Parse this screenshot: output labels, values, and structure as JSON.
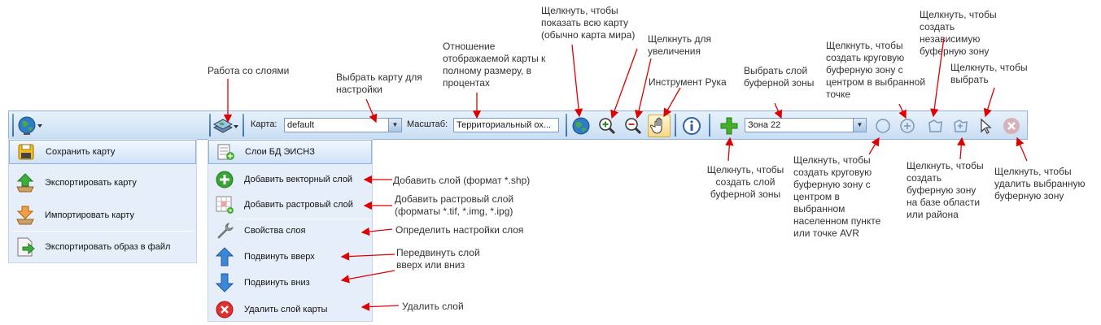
{
  "toolbar": {
    "map_label": "Карта:",
    "map_value": "default",
    "scale_label": "Масштаб:",
    "scale_value": "Территориальный ох...",
    "zone_value": "Зона 22"
  },
  "left_menu": {
    "items": [
      {
        "label": "Сохранить карту"
      },
      {
        "label": "Экспортировать карту"
      },
      {
        "label": "Импортировать карту"
      },
      {
        "label": "Экспортировать образ в файл"
      }
    ]
  },
  "layer_menu": {
    "items": [
      {
        "label": "Слои БД ЭИСНЗ"
      },
      {
        "label": "Добавить векторный слой"
      },
      {
        "label": "Добавить растровый слой"
      },
      {
        "label": "Свойства слоя"
      },
      {
        "label": "Подвинуть вверх"
      },
      {
        "label": "Подвинуть вниз"
      },
      {
        "label": "Удалить слой карты"
      }
    ]
  },
  "annotations": {
    "layers": "Работа со слоями",
    "choose_map": "Выбрать карту для настройки",
    "ratio": "Отношение отображаемой карты к полному размеру, в процентах",
    "whole_map": "Щелкнуть, чтобы показать всю карту (обычно карта мира)",
    "zoom_in": "Щелкнуть для увеличения",
    "hand": "Инструмент Рука",
    "buffer_layer": "Выбрать слой буферной зоны",
    "circle_point": "Щелкнуть, чтобы создать круговую буферную зону с центром в выбранной точке",
    "independent": "Щелкнуть, чтобы создать независимую буферную зону",
    "select": "Щелкнуть, чтобы выбрать",
    "create_layer": "Щелкнуть, чтобы создать слой буферной зоны",
    "circle_city": "Щелкнуть, чтобы создать круговую буферную зону с центром в выбранном населенном пункте или точке AVR",
    "area": "Щелкнуть, чтобы создать буферную зону на базе области или района",
    "delete_zone": "Щелкнуть, чтобы удалить выбранную буферную зону",
    "add_vector": "Добавить слой (формат *.shp)",
    "add_raster": "Добавить растровый слой (форматы *.tif, *.img, *.ipg)",
    "layer_settings": "Определить настройки слоя",
    "move": "Передвинуть слой вверх или вниз",
    "delete_layer": "Удалить слой"
  },
  "colors": {
    "arrow": "#e00000",
    "accent": "#3d6fa8"
  }
}
